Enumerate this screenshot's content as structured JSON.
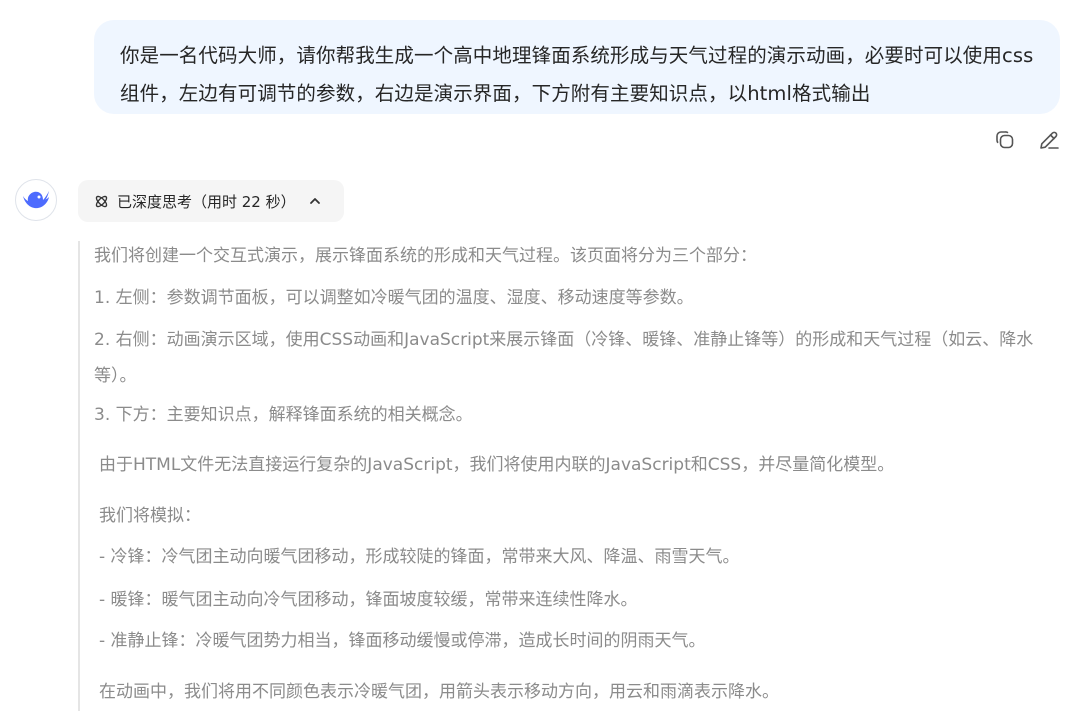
{
  "user_message": {
    "text": "你是一名代码大师，请你帮我生成一个高中地理锋面系统形成与天气过程的演示动画，必要时可以使用css组件，左边有可调节的参数，右边是演示界面，下方附有主要知识点，以html格式输出"
  },
  "message_actions": [
    {
      "icon": "copy-icon"
    },
    {
      "icon": "edit-icon"
    }
  ],
  "assistant": {
    "avatar_icon": "deepseek-whale-icon",
    "thinking": {
      "icon": "atom-icon",
      "label": "已深度思考（用时 22 秒）",
      "toggle_icon": "chevron-up-icon"
    },
    "thinking_lines": [
      "我们将创建一个交互式演示，展示锋面系统的形成和天气过程。该页面将分为三个部分：",
      "1. 左侧：参数调节面板，可以调整如冷暖气团的温度、湿度、移动速度等参数。",
      "2. 右侧：动画演示区域，使用CSS动画和JavaScript来展示锋面（冷锋、暖锋、准静止锋等）的形成和天气过程（如云、降水等）。",
      "3. 下方：主要知识点，解释锋面系统的相关概念。",
      "由于HTML文件无法直接运行复杂的JavaScript，我们将使用内联的JavaScript和CSS，并尽量简化模型。",
      "我们将模拟：",
      "- 冷锋：冷气团主动向暖气团移动，形成较陡的锋面，常带来大风、降温、雨雪天气。",
      "- 暖锋：暖气团主动向冷气团移动，锋面坡度较缓，常带来连续性降水。",
      "- 准静止锋：冷暖气团势力相当，锋面移动缓慢或停滞，造成长时间的阴雨天气。",
      "在动画中，我们将用不同颜色表示冷暖气团，用箭头表示移动方向，用云和雨滴表示降水。"
    ]
  },
  "colors": {
    "bubble_bg": "#eff6ff",
    "brand": "#4d6bfe",
    "think_text": "#8b8b8b"
  }
}
